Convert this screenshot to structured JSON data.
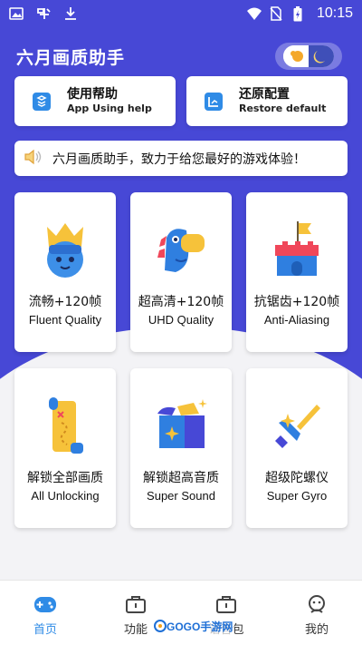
{
  "status_bar": {
    "time": "10:15",
    "left_icons": [
      "image-icon",
      "app-icon",
      "download-icon"
    ],
    "right_icons": [
      "wifi-icon",
      "no-sim-icon",
      "battery-charging-icon"
    ]
  },
  "header": {
    "title": "六月画质助手",
    "toggle_icon": "day-night-toggle-icon"
  },
  "quick_actions": [
    {
      "title": "使用帮助",
      "subtitle": "App Using help",
      "icon": "help-book-icon"
    },
    {
      "title": "还原配置",
      "subtitle": "Restore default",
      "icon": "restore-chart-icon"
    }
  ],
  "notice": {
    "icon": "speaker-icon",
    "text": "六月画质助手，致力于给您最好的游戏体验！"
  },
  "features": [
    {
      "title": "流畅+120帧",
      "subtitle": "Fluent Quality",
      "icon": "crown-face-icon"
    },
    {
      "title": "超高清+120帧",
      "subtitle": "UHD Quality",
      "icon": "dragon-icon"
    },
    {
      "title": "抗锯齿+120帧",
      "subtitle": "Anti-Aliasing",
      "icon": "castle-flag-icon"
    },
    {
      "title": "解锁全部画质",
      "subtitle": "All Unlocking",
      "icon": "treasure-map-icon"
    },
    {
      "title": "解锁超高音质",
      "subtitle": "Super Sound",
      "icon": "treasure-box-icon"
    },
    {
      "title": "超级陀螺仪",
      "subtitle": "Super Gyro",
      "icon": "sword-icon"
    }
  ],
  "bottom_nav": [
    {
      "label": "首页",
      "icon": "gamepad-icon",
      "active": true
    },
    {
      "label": "功能",
      "icon": "toolbox-icon",
      "active": false
    },
    {
      "label": "语音包",
      "icon": "toolbox-icon",
      "active": false
    },
    {
      "label": "我的",
      "icon": "user-icon",
      "active": false
    }
  ],
  "watermark": {
    "text": "GOGO手游网"
  },
  "colors": {
    "primary": "#4748d6",
    "accent": "#2f8be6",
    "background": "#f3f3f6"
  }
}
